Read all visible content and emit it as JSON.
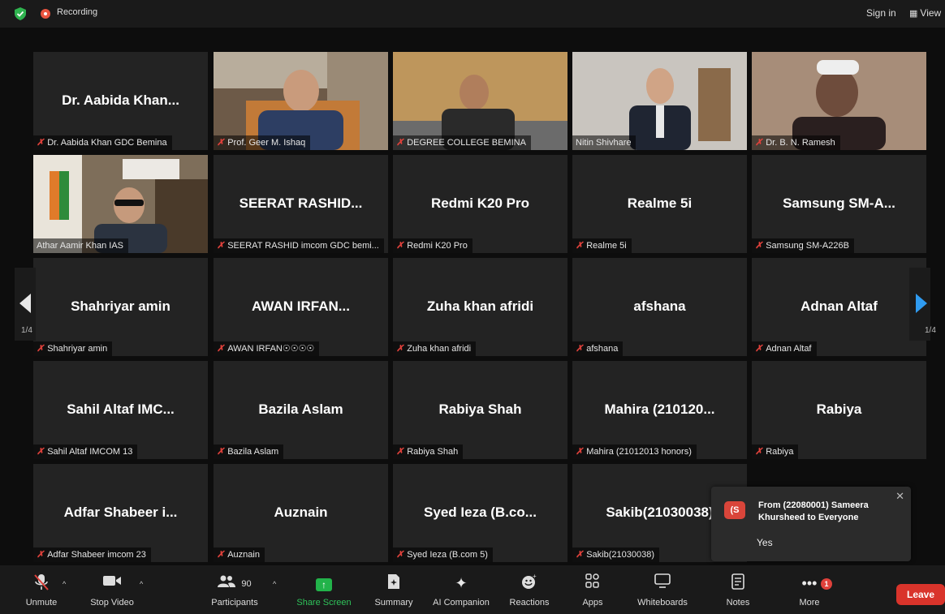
{
  "topbar": {
    "recording": "Recording",
    "sign_in": "Sign in",
    "view": "View"
  },
  "tiles": [
    {
      "big": "Dr. Aabida Khan...",
      "label": "Dr. Aabida Khan GDC Bemina",
      "muted": true
    },
    {
      "big": "",
      "label": "Prof. Geer M. Ishaq",
      "muted": true,
      "video": true
    },
    {
      "big": "",
      "label": "DEGREE COLLEGE BEMINA",
      "muted": true,
      "video": true
    },
    {
      "big": "",
      "label": "Nitin Shivhare",
      "muted": false,
      "video": true
    },
    {
      "big": "",
      "label": "Dr. B. N. Ramesh",
      "muted": true,
      "video": true
    },
    {
      "big": "",
      "label": "Athar Aamir Khan IAS",
      "muted": false,
      "video": true,
      "highlight": true
    },
    {
      "big": "SEERAT RASHID...",
      "label": "SEERAT RASHID imcom GDC bemi...",
      "muted": true
    },
    {
      "big": "Redmi K20 Pro",
      "label": "Redmi K20 Pro",
      "muted": true
    },
    {
      "big": "Realme 5i",
      "label": "Realme 5i",
      "muted": true
    },
    {
      "big": "Samsung SM-A...",
      "label": "Samsung SM-A226B",
      "muted": true
    },
    {
      "big": "Shahriyar amin",
      "label": "Shahriyar amin",
      "muted": true
    },
    {
      "big": "AWAN IRFAN...",
      "label": "AWAN IRFAN☉☉☉☉",
      "muted": true
    },
    {
      "big": "Zuha khan afridi",
      "label": "Zuha khan afridi",
      "muted": true
    },
    {
      "big": "afshana",
      "label": "afshana",
      "muted": true
    },
    {
      "big": "Adnan Altaf",
      "label": "Adnan Altaf",
      "muted": true
    },
    {
      "big": "Sahil Altaf IMC...",
      "label": "Sahil Altaf IMCOM 13",
      "muted": true
    },
    {
      "big": "Bazila Aslam",
      "label": "Bazila Aslam",
      "muted": true
    },
    {
      "big": "Rabiya Shah",
      "label": "Rabiya Shah",
      "muted": true
    },
    {
      "big": "Mahira (210120...",
      "label": "Mahira (21012013 honors)",
      "muted": true
    },
    {
      "big": "Rabiya",
      "label": "Rabiya",
      "muted": true
    },
    {
      "big": "Adfar Shabeer i...",
      "label": "Adfar Shabeer imcom 23",
      "muted": true
    },
    {
      "big": "Auznain",
      "label": "Auznain",
      "muted": true
    },
    {
      "big": "Syed Ieza (B.co...",
      "label": "Syed Ieza (B.com 5)",
      "muted": true
    },
    {
      "big": "Sakib(21030038)",
      "label": "Sakib(21030038)",
      "muted": true
    }
  ],
  "pager": {
    "left": "1/4",
    "right": "1/4"
  },
  "chat": {
    "avatar": "(S",
    "from": "From (22080001) Sameera Khursheed to Everyone",
    "message": "Yes"
  },
  "toolbar": {
    "unmute": "Unmute",
    "stop_video": "Stop Video",
    "participants": "Participants",
    "participants_count": "90",
    "share": "Share Screen",
    "summary": "Summary",
    "ai": "AI Companion",
    "reactions": "Reactions",
    "apps": "Apps",
    "whiteboards": "Whiteboards",
    "notes": "Notes",
    "more": "More",
    "more_badge": "1",
    "leave": "Leave"
  },
  "colors": {
    "accent_green": "#22b34a",
    "leave_red": "#d9342b",
    "highlight": "#e8e28a",
    "muted_red": "#e0413b"
  }
}
